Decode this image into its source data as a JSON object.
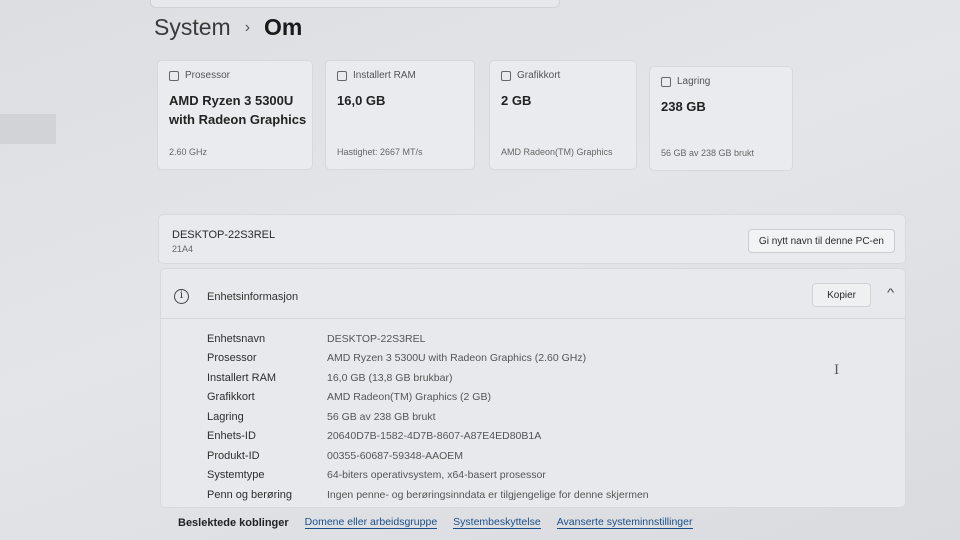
{
  "breadcrumb": {
    "parent": "System",
    "separator": "›",
    "current": "Om"
  },
  "specs": [
    {
      "label": "Prosessor",
      "value": "AMD Ryzen 3 5300U with Radeon Graphics",
      "detail": "2.60 GHz",
      "icon": "chip-icon"
    },
    {
      "label": "Installert RAM",
      "value": "16,0 GB",
      "detail": "Hastighet: 2667 MT/s",
      "icon": "memory-icon"
    },
    {
      "label": "Grafikkort",
      "value": "2 GB",
      "detail": "AMD Radeon(TM) Graphics",
      "icon": "gpu-icon"
    },
    {
      "label": "Lagring",
      "value": "238 GB",
      "detail": "56 GB av 238 GB brukt",
      "icon": "storage-icon"
    }
  ],
  "pc": {
    "name": "DESKTOP-22S3REL",
    "model": "21A4",
    "rename_label": "Gi nytt navn til denne PC-en"
  },
  "device_spec": {
    "title": "Enhetsinformasjon",
    "copy_label": "Kopier",
    "rows": [
      {
        "key": "Enhetsnavn",
        "value": "DESKTOP-22S3REL"
      },
      {
        "key": "Prosessor",
        "value": "AMD Ryzen 3 5300U with Radeon Graphics (2.60 GHz)"
      },
      {
        "key": "Installert RAM",
        "value": "16,0 GB (13,8 GB brukbar)"
      },
      {
        "key": "Grafikkort",
        "value": "AMD Radeon(TM) Graphics (2 GB)"
      },
      {
        "key": "Lagring",
        "value": "56 GB av 238 GB brukt"
      },
      {
        "key": "Enhets-ID",
        "value": "20640D7B-1582-4D7B-8607-A87E4ED80B1A"
      },
      {
        "key": "Produkt-ID",
        "value": "00355-60687-59348-AAOEM"
      },
      {
        "key": "Systemtype",
        "value": "64-biters operativsystem, x64-basert prosessor"
      },
      {
        "key": "Penn og berøring",
        "value": "Ingen penne- og berøringsinndata er tilgjengelige for denne skjermen"
      }
    ]
  },
  "related": {
    "label": "Beslektede koblinger",
    "links": [
      "Domene eller arbeidsgruppe",
      "Systembeskyttelse",
      "Avanserte systeminnstillinger"
    ]
  }
}
